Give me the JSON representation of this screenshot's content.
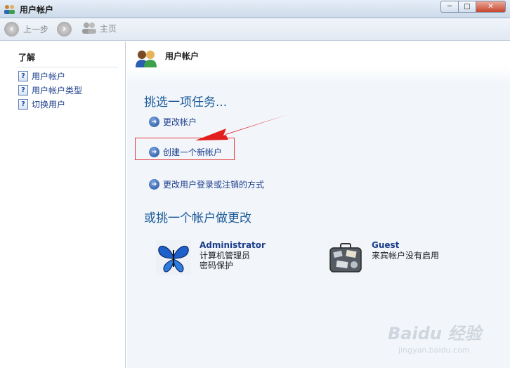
{
  "window": {
    "title": "用户帐户",
    "buttons": {
      "minimize": "─",
      "maximize": "□",
      "close": "✕"
    }
  },
  "toolbar": {
    "back_label": "上一步",
    "home_label": "主页"
  },
  "sidebar": {
    "heading": "了解",
    "items": [
      {
        "label": "用户帐户"
      },
      {
        "label": "用户帐户类型"
      },
      {
        "label": "切换用户"
      }
    ]
  },
  "main": {
    "header_title": "用户帐户",
    "pick_task_heading": "挑选一项任务...",
    "tasks": [
      {
        "label": "更改帐户"
      },
      {
        "label": "创建一个新帐户"
      },
      {
        "label": "更改用户登录或注销的方式"
      }
    ],
    "pick_account_heading": "或挑一个帐户做更改",
    "accounts": [
      {
        "name": "Administrator",
        "lines": [
          "计算机管理员",
          "密码保护"
        ],
        "picture": "butterfly-icon"
      },
      {
        "name": "Guest",
        "lines": [
          "来宾帐户没有启用"
        ],
        "picture": "suitcase-icon"
      }
    ]
  },
  "watermark": {
    "text": "Baidu 经验",
    "url": "jingyan.baidu.com"
  },
  "colors": {
    "link": "#1a3c8a",
    "heading": "#1c5a96",
    "highlight": "#e03a3a"
  }
}
